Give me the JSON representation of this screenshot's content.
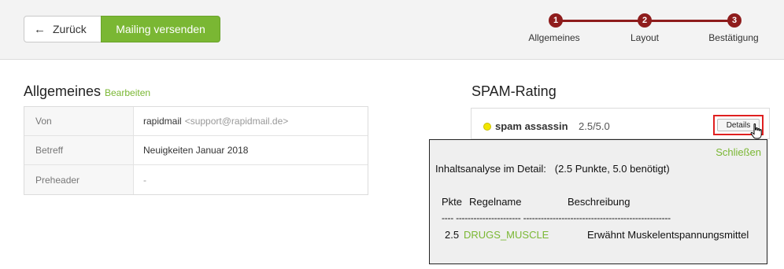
{
  "toolbar": {
    "back_label": "Zurück",
    "send_label": "Mailing versenden"
  },
  "stepper": {
    "steps": [
      {
        "number": "1",
        "label": "Allgemeines"
      },
      {
        "number": "2",
        "label": "Layout"
      },
      {
        "number": "3",
        "label": "Bestätigung"
      }
    ],
    "color": "#8e1c1c"
  },
  "general": {
    "title": "Allgemeines",
    "edit_label": "Bearbeiten",
    "rows": [
      {
        "label": "Von",
        "value": "rapidmail",
        "muted": "<support@rapidmail.de>"
      },
      {
        "label": "Betreff",
        "value": "Neuigkeiten Januar 2018",
        "muted": ""
      },
      {
        "label": "Preheader",
        "value": "-",
        "muted": ""
      }
    ]
  },
  "spam": {
    "title": "SPAM-Rating",
    "engine": "spam assassin",
    "score": "2.5/5.0",
    "status_color": "#f2e600",
    "details_label": "Details"
  },
  "popup": {
    "close_label": "Schließen",
    "summary": "Inhaltsanalyse im Detail:   (2.5 Punkte, 5.0 benötigt)",
    "col_pts": "Pkte",
    "col_rule": "Regelname",
    "col_desc": "Beschreibung",
    "separator": "---- ---------------------- --------------------------------------------------",
    "rows": [
      {
        "pts": "2.5",
        "rule": "DRUGS_MUSCLE",
        "desc": "Erwähnt Muskelentspannungsmittel"
      }
    ]
  },
  "accent_color": "#7ab733"
}
